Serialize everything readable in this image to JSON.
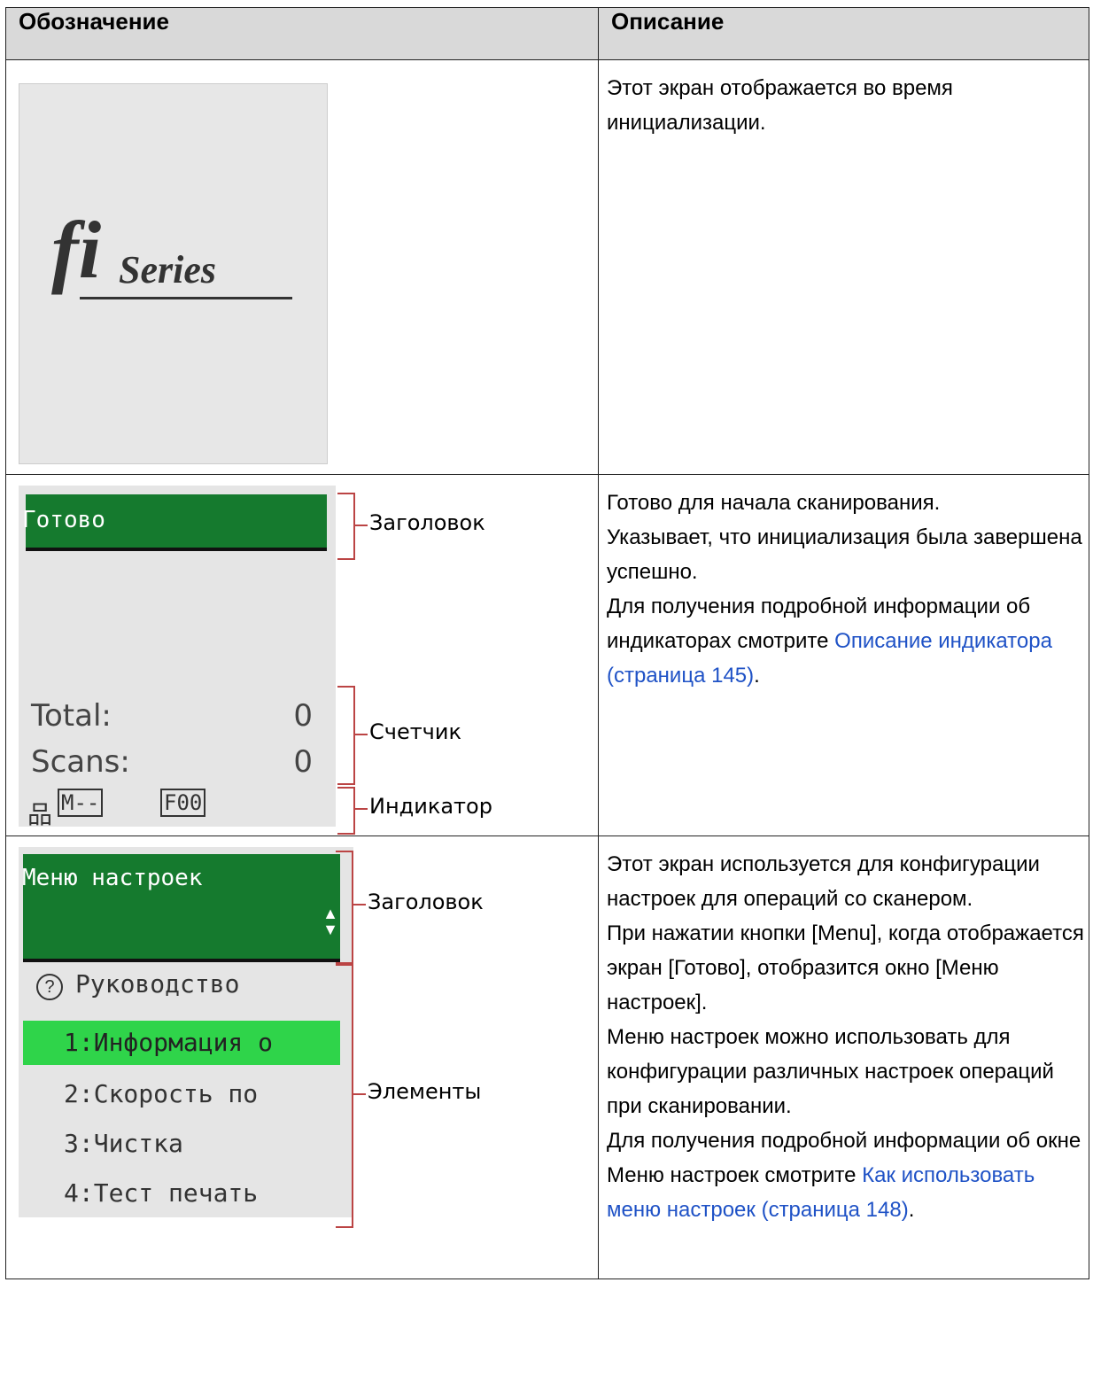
{
  "table": {
    "header": {
      "col1": "Обозначение",
      "col2": "Описание"
    },
    "rows": [
      {
        "logo": {
          "text_fi": "fi",
          "text_series": "Series"
        },
        "description": [
          "Этот экран отображается во время инициализации."
        ]
      },
      {
        "screen": {
          "title": "Готово",
          "counter_rows": [
            {
              "label": "Total:",
              "value": "0"
            },
            {
              "label": "Scans:",
              "value": "0"
            }
          ],
          "indicator_mode": "M--",
          "indicator_feed": "F00"
        },
        "callouts": {
          "title": "Заголовок",
          "counter": "Счетчик",
          "indicator": "Индикатор"
        },
        "description": {
          "p1": "Готово для начала сканирования.",
          "p2": "Указывает, что инициализация была завершена успешно.",
          "p3_prefix": "Для получения подробной информации об индикаторах смотрите ",
          "p3_link": "Описание индикатора (страница 145)",
          "p3_suffix": "."
        }
      },
      {
        "screen": {
          "title": "Меню настроек",
          "guide": "Руководство",
          "items": [
            "1:Информация о",
            "2:Скорость по",
            "3:Чистка",
            "4:Тест печать"
          ],
          "selected_index": 0
        },
        "callouts": {
          "title": "Заголовок",
          "items": "Элементы"
        },
        "description": {
          "p1": "Этот экран используется для конфигурации настроек для операций со сканером.",
          "p2": "При нажатии кнопки [Menu], когда отображается экран [Готово], отобразится окно [Меню настроек].",
          "p3": "Меню настроек можно использовать для конфигурации различных настроек операций при сканировании.",
          "p4_prefix": "Для получения подробной информации об окне Меню настроек смотрите ",
          "p4_link": "Как использовать меню настроек (страница 148)",
          "p4_suffix": "."
        }
      }
    ]
  },
  "colors": {
    "header_bg": "#d9d9d9",
    "title_bar": "#157a2e",
    "selected_item": "#2fd44a",
    "link": "#1f52c6",
    "bracket": "#bb4444"
  }
}
